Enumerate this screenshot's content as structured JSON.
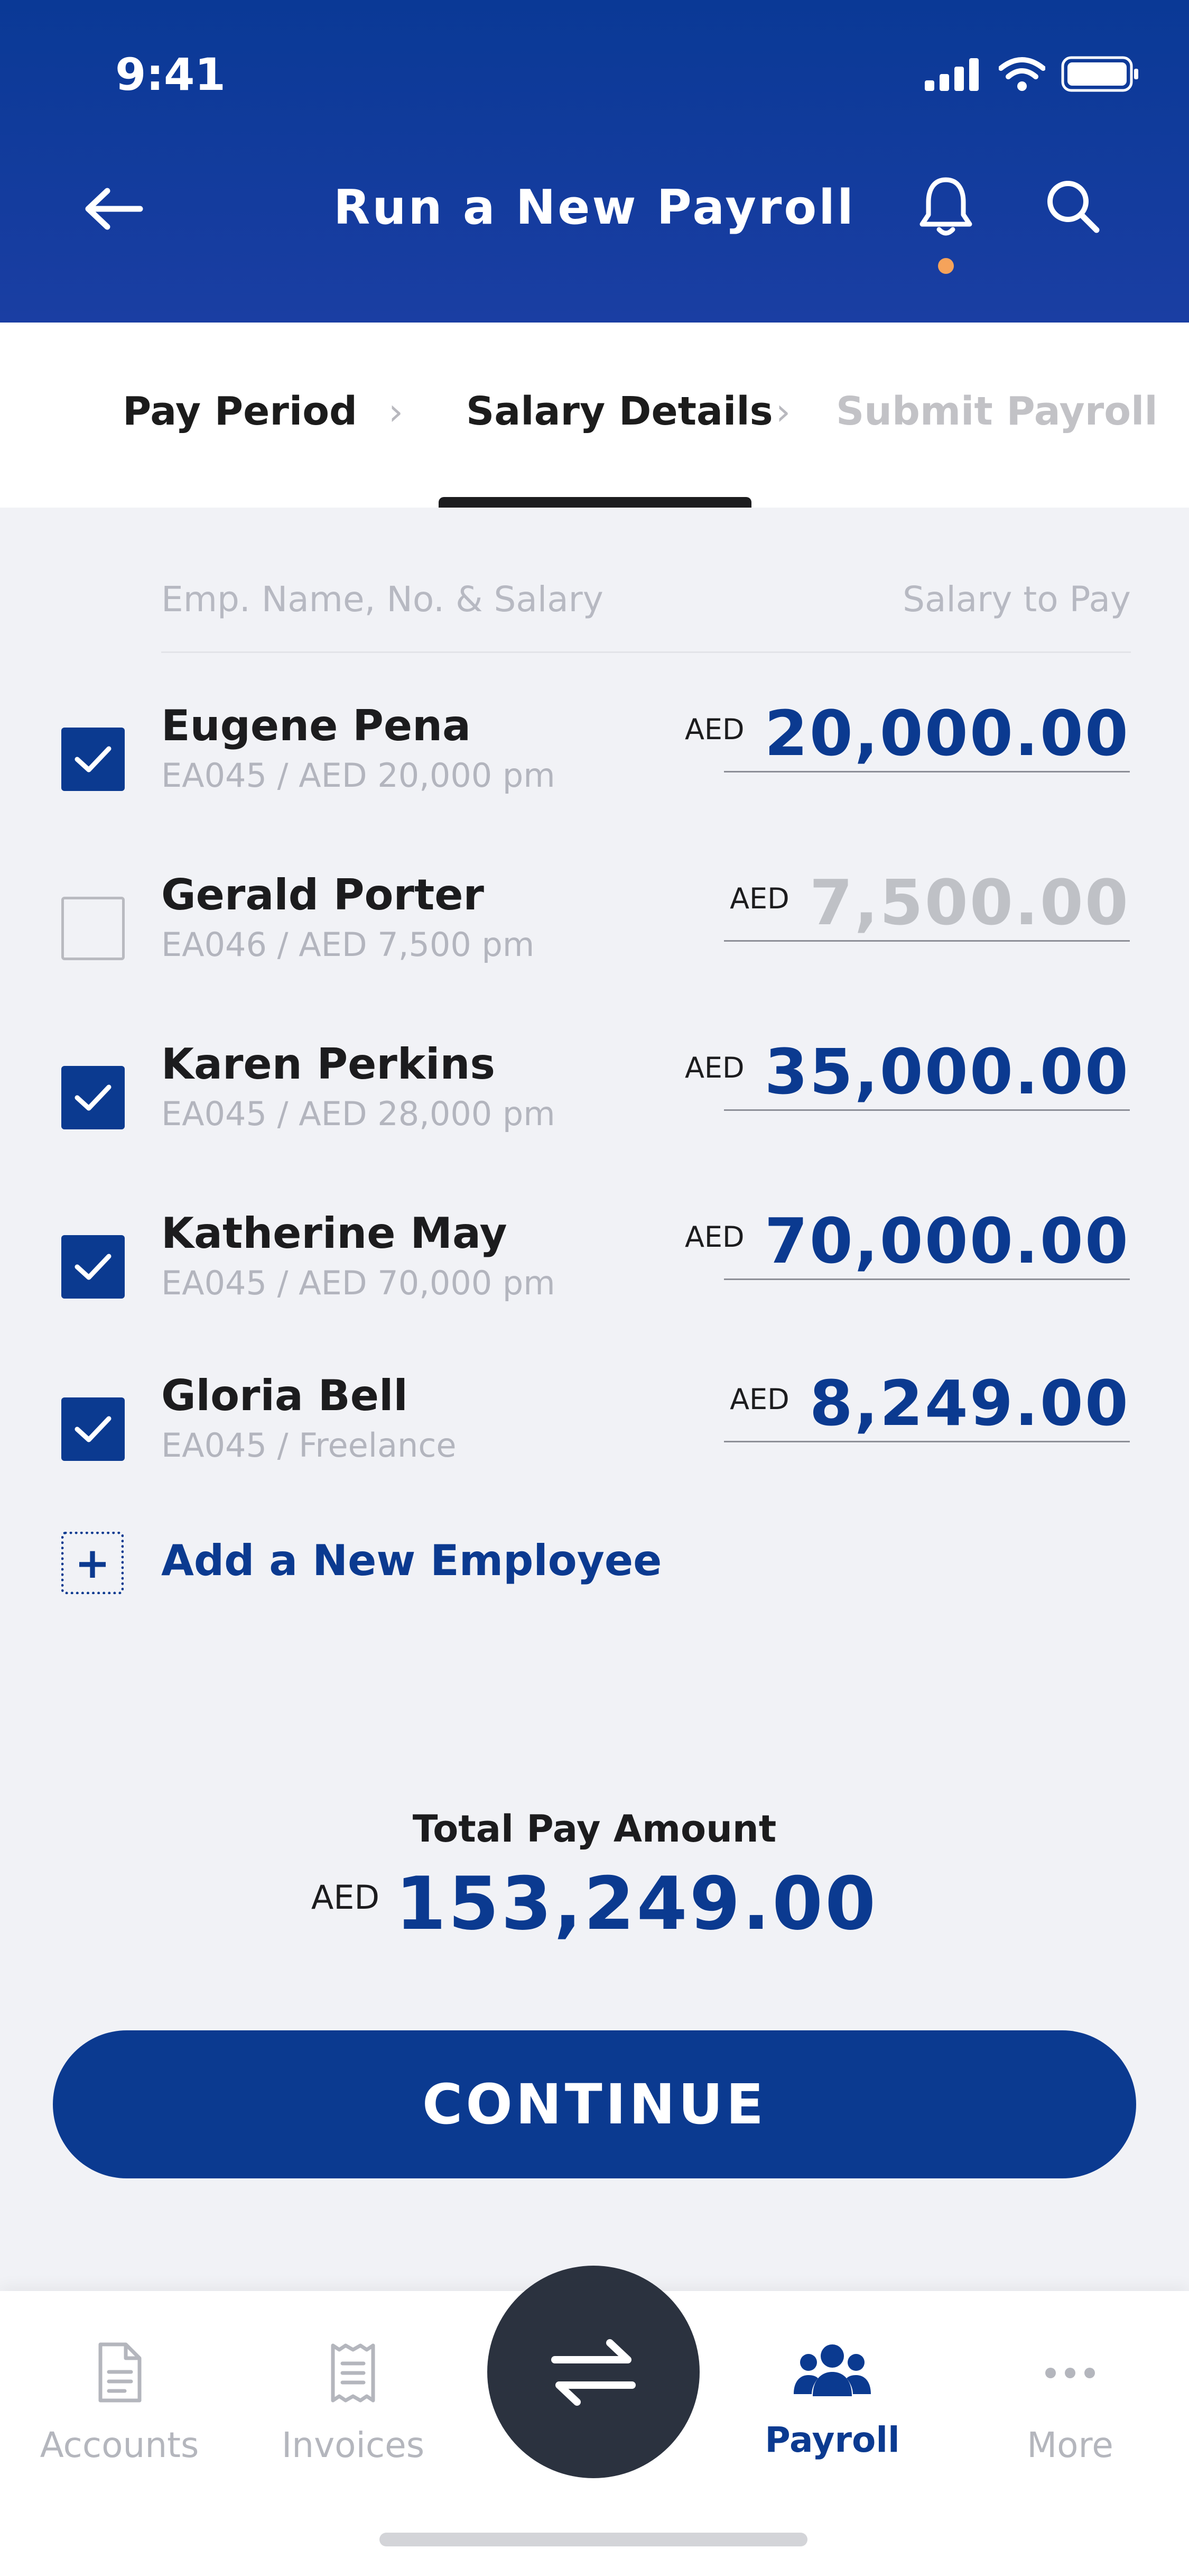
{
  "status_bar": {
    "time": "9:41"
  },
  "header": {
    "title": "Run a New Payroll"
  },
  "stepper": {
    "steps": [
      {
        "label": "Pay Period",
        "state": "done"
      },
      {
        "label": "Salary Details",
        "state": "active"
      },
      {
        "label": "Submit Payroll",
        "state": "upcoming"
      }
    ]
  },
  "table": {
    "col_left": "Emp. Name, No. & Salary",
    "col_right": "Salary to Pay",
    "rows": [
      {
        "name": "Eugene Pena",
        "sub": "EA045 / AED 20,000 pm",
        "currency": "AED",
        "amount": "20,000.00",
        "checked": true
      },
      {
        "name": "Gerald Porter",
        "sub": "EA046 / AED 7,500 pm",
        "currency": "AED",
        "amount": "7,500.00",
        "checked": false
      },
      {
        "name": "Karen Perkins",
        "sub": "EA045 / AED 28,000 pm",
        "currency": "AED",
        "amount": "35,000.00",
        "checked": true
      },
      {
        "name": "Katherine May",
        "sub": "EA045 / AED 70,000 pm",
        "currency": "AED",
        "amount": "70,000.00",
        "checked": true
      },
      {
        "name": "Gloria Bell",
        "sub": "EA045 / Freelance",
        "currency": "AED",
        "amount": "8,249.00",
        "checked": true
      }
    ]
  },
  "add_employee": {
    "label": "Add a New Employee"
  },
  "total": {
    "label": "Total Pay Amount",
    "currency": "AED",
    "amount": "153,249.00"
  },
  "continue_button": {
    "label": "CONTINUE"
  },
  "bottom_nav": {
    "items": [
      {
        "label": "Accounts",
        "icon": "document-icon",
        "active": false
      },
      {
        "label": "Invoices",
        "icon": "receipt-icon",
        "active": false
      },
      {
        "label": "Payroll",
        "icon": "people-icon",
        "active": true
      },
      {
        "label": "More",
        "icon": "more-icon",
        "active": false
      }
    ],
    "center_icon": "transfer-icon"
  },
  "colors": {
    "primary": "#0b3a90",
    "header_bg": "#0a3996",
    "notification_dot": "#f5a35b",
    "fab_bg": "#2b323f",
    "background": "#f1f2f6"
  }
}
